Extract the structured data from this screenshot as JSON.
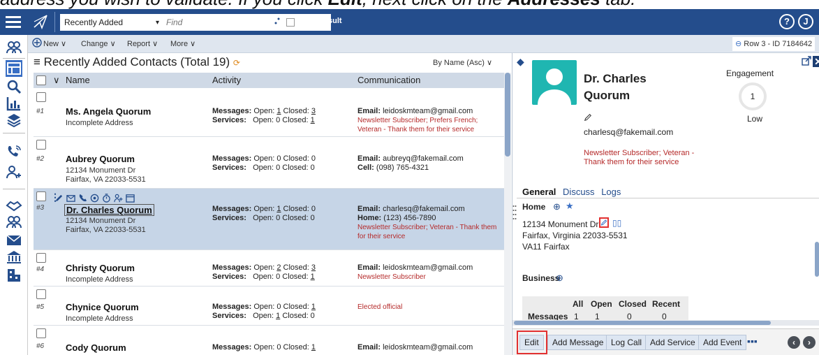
{
  "caption": {
    "before": "address you wish to validate. If you click ",
    "edit_word": "Edit",
    "middle": ", next click on the ",
    "addresses_word": "Addresses",
    "after": " tab."
  },
  "topbar": {
    "select_value": "Recently Added",
    "find_placeholder": "Find",
    "filter_label": "Filter Result",
    "help": "?",
    "user": "J"
  },
  "toolbar": {
    "new": "New ∨",
    "change": "Change ∨",
    "report": "Report ∨",
    "more": "More ∨",
    "row_id": "Row 3 - ID 7184642"
  },
  "list": {
    "title": "Recently Added Contacts (Total 19)",
    "sort": "By Name (Asc) ∨",
    "columns": {
      "sort_toggle": "∨",
      "name": "Name",
      "activity": "Activity",
      "communication": "Communication"
    },
    "rows": [
      {
        "num": "#1",
        "name": "Ms. Angela Quorum",
        "addr1": "Incomplete Address",
        "addr2": "",
        "msg_label": "Messages:",
        "msg_open": "Open: ",
        "msg_open_n": "1",
        "msg_closed": " Closed: ",
        "msg_closed_n": "3",
        "svc_label": "Services:",
        "svc_open": "Open: 0 Closed: ",
        "svc_closed_n": "1",
        "com_label": "Email:",
        "com_value": "leidoskmteam@gmail.com",
        "com2_label": "",
        "com2_value": "",
        "tags": "Newsletter Subscriber; Prefers French; Veteran - Thank them for their service"
      },
      {
        "num": "#2",
        "name": "Aubrey Quorum",
        "addr1": "12134 Monument Dr",
        "addr2": "Fairfax, VA 22033-5531",
        "msg_label": "Messages:",
        "msg_open": "Open: 0 Closed: 0",
        "msg_open_n": "",
        "msg_closed": "",
        "msg_closed_n": "",
        "svc_label": "Services:",
        "svc_open": "Open: 0 Closed: 0",
        "svc_closed_n": "",
        "com_label": "Email:",
        "com_value": "aubreyq@fakemail.com",
        "com2_label": "Cell:",
        "com2_value": "(098) 765-4321",
        "tags": ""
      },
      {
        "num": "#3",
        "name": "Dr. Charles Quorum",
        "addr1": "12134 Monument Dr",
        "addr2": "Fairfax, VA 22033-5531",
        "msg_label": "Messages:",
        "msg_open": "Open: ",
        "msg_open_n": "1",
        "msg_closed": " Closed: 0",
        "msg_closed_n": "",
        "svc_label": "Services:",
        "svc_open": "Open: 0 Closed: 0",
        "svc_closed_n": "",
        "com_label": "Email:",
        "com_value": "charlesq@fakemail.com",
        "com2_label": "Home:",
        "com2_value": "(123) 456-7890",
        "tags": "Newsletter Subscriber; Veteran - Thank them for their service"
      },
      {
        "num": "#4",
        "name": "Christy Quorum",
        "addr1": "Incomplete Address",
        "addr2": "",
        "msg_label": "Messages:",
        "msg_open": "Open: ",
        "msg_open_n": "2",
        "msg_closed": " Closed: ",
        "msg_closed_n": "3",
        "svc_label": "Services:",
        "svc_open": "Open: 0 Closed: ",
        "svc_closed_n": "1",
        "com_label": "Email:",
        "com_value": "leidoskmteam@gmail.com",
        "com2_label": "",
        "com2_value": "",
        "tags": "Newsletter Subscriber"
      },
      {
        "num": "#5",
        "name": "Chynice Quorum",
        "addr1": "Incomplete Address",
        "addr2": "",
        "msg_label": "Messages:",
        "msg_open": "Open: 0 Closed: ",
        "msg_open_n": "",
        "msg_closed": "",
        "msg_closed_n": "1",
        "svc_label": "Services:",
        "svc_open": "Open: ",
        "svc_closed_n": "1",
        "svc_tail": " Closed: 0",
        "com_label": "",
        "com_value": "",
        "com2_label": "",
        "com2_value": "",
        "tags": "Elected official"
      },
      {
        "num": "#6",
        "name": "Cody Quorum",
        "addr1": "",
        "addr2": "",
        "msg_label": "Messages:",
        "msg_open": "Open: 0 Closed: ",
        "msg_open_n": "",
        "msg_closed": "",
        "msg_closed_n": "1",
        "svc_label": "",
        "svc_open": "",
        "svc_closed_n": "",
        "com_label": "Email:",
        "com_value": "leidoskmteam@gmail.com",
        "com2_label": "",
        "com2_value": "",
        "tags": ""
      }
    ]
  },
  "detail": {
    "name": "Dr. Charles Quorum",
    "email": "charlesq@fakemail.com",
    "tags": "Newsletter Subscriber; Veteran - Thank them for their service",
    "engagement_label": "Engagement",
    "engagement_value": "1",
    "engagement_level": "Low",
    "tabs": [
      "General",
      "Discuss",
      "Logs"
    ],
    "home_label": "Home",
    "address_line1": "12134 Monument Dr",
    "address_line2": "Fairfax, Virginia 22033-5531",
    "address_line3": "VA11 Fairfax",
    "business_label": "Business",
    "stats_headers": [
      "All",
      "Open",
      "Closed",
      "Recent"
    ],
    "stats_row_label": "Messages",
    "stats_values": [
      "1",
      "1",
      "0",
      "0"
    ],
    "actions": {
      "edit": "Edit",
      "add_message": "Add Message",
      "log_call": "Log Call",
      "add_service": "Add Service",
      "add_event": "Add Event",
      "more": "▪▪▪"
    }
  },
  "colors": {
    "topbar": "#244d8c",
    "selected_row": "#c6d5e7",
    "tag_red": "#b52a2a",
    "highlight": "#e23030",
    "avatar": "#1fb6b1"
  }
}
